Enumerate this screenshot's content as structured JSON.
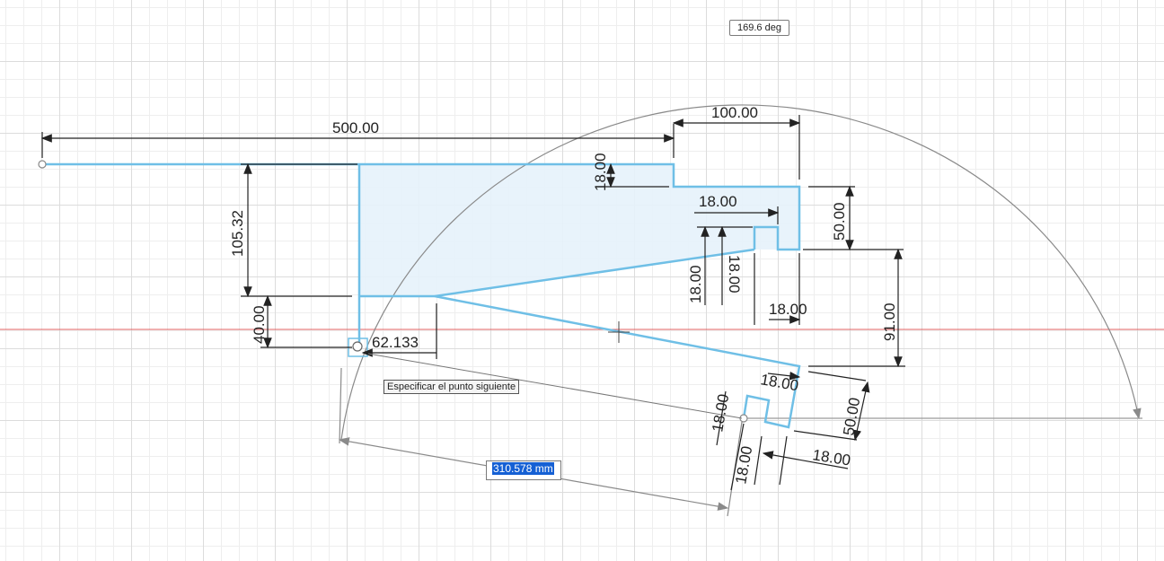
{
  "dimensions": {
    "d500": "500.00",
    "d100": "100.00",
    "d18_top": "18.00",
    "d105": "105.32",
    "d18_inner": "18.00",
    "d50_right": "50.00",
    "d18_vert_a": "18.00",
    "d18_vert_b": "18.00",
    "d18_small": "18.00",
    "d91": "91.00",
    "d40": "40.00",
    "d62": "62.133",
    "d18_rot_a": "18.00",
    "d18_rot_b": "18.00",
    "d18_rot_c": "18.00",
    "d50_rot": "50.00",
    "d18_rot_d": "18.00"
  },
  "angle_readout": "169.6 deg",
  "tooltip": "Especificar el punto siguiente",
  "length_input": "310.578 mm",
  "colors": {
    "profile": "#6fbfe6",
    "axis": "#e06060",
    "fill": "#e6f2fb"
  }
}
